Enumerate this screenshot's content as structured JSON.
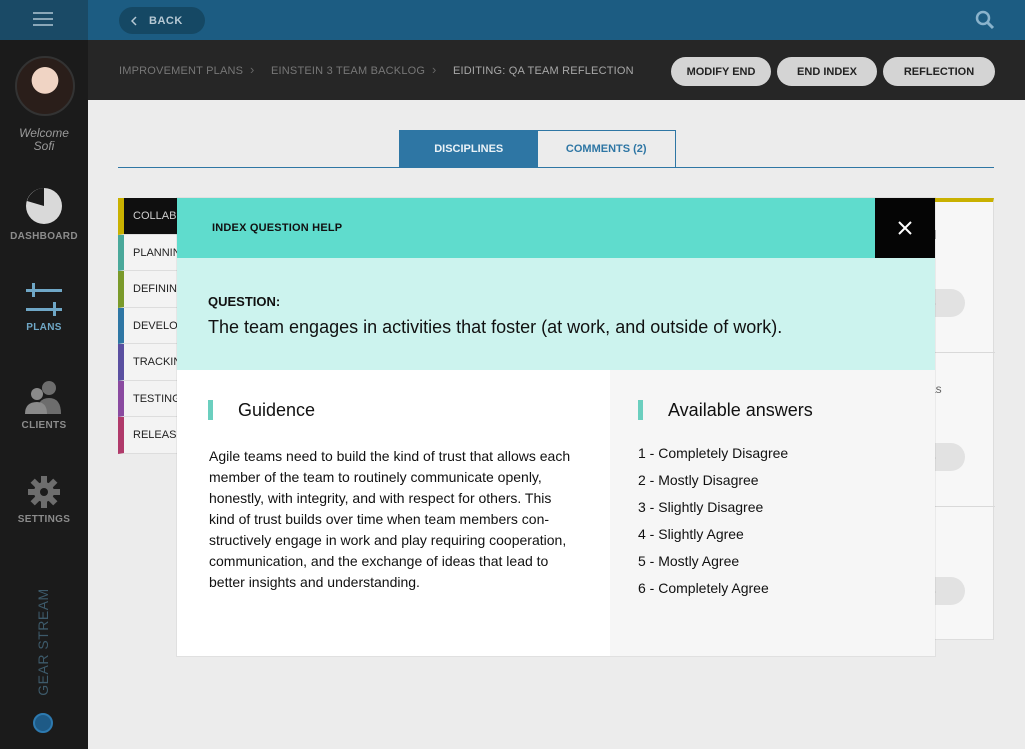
{
  "sidebar": {
    "welcome": "Welcome",
    "user_name": "Sofi",
    "nav": [
      {
        "label": "DASHBOARD",
        "icon": "pie-chart-icon"
      },
      {
        "label": "PLANS",
        "icon": "sliders-icon"
      },
      {
        "label": "CLIENTS",
        "icon": "users-icon"
      },
      {
        "label": "SETTINGS",
        "icon": "gear-icon"
      }
    ],
    "brand": "GEAR STREAM"
  },
  "topbar": {
    "back_label": "BACK"
  },
  "breadcrumb": {
    "items": [
      "IMPROVEMENT PLANS",
      "EINSTEIN 3 TEAM BACKLOG",
      "EIDITING: QA TEAM REFLECTION"
    ]
  },
  "actions": [
    "MODIFY END",
    "END INDEX",
    "REFLECTION"
  ],
  "tabs": [
    "DISCIPLINES",
    "COMMENTS (2)"
  ],
  "disciplines": [
    {
      "label": "COLLAB",
      "color": "#c9b100"
    },
    {
      "label": "PLANNIN",
      "color": "#4aa89a"
    },
    {
      "label": "DEFININ",
      "color": "#7a9a2a"
    },
    {
      "label": "DEVELO",
      "color": "#2e76a4"
    },
    {
      "label": "TRACKIN",
      "color": "#5a4fa0"
    },
    {
      "label": "TESTING",
      "color": "#8a4aa0"
    },
    {
      "label": "RELEAS",
      "color": "#b03a6a"
    }
  ],
  "right_panel_peeks": [
    "s",
    "as",
    "s",
    "s",
    "d"
  ],
  "modal": {
    "title": "INDEX QUESTION HELP",
    "question_label": "QUESTION:",
    "question_text": "The team engages in activities that foster (at work, and outside of work).",
    "guidance_title": "Guidence",
    "guidance_lines": [
      "Agile teams need to build the kind of trust that allows each",
      "member of the team to routinely communicate openly,",
      "honestly, with integrity, and with respect for others. This",
      "kind of trust builds over time when team members con-",
      "structively engage in work and play requiring cooperation,",
      "communication, and the exchange of ideas that lead to",
      "better insights and understanding."
    ],
    "answers_title": "Available answers",
    "answers": [
      "1 - Completely Disagree",
      "2 - Mostly Disagree",
      "3 - Slightly Disagree",
      "4 - Slightly Agree",
      "5 - Mostly Agree",
      "6 - Completely Agree"
    ]
  }
}
